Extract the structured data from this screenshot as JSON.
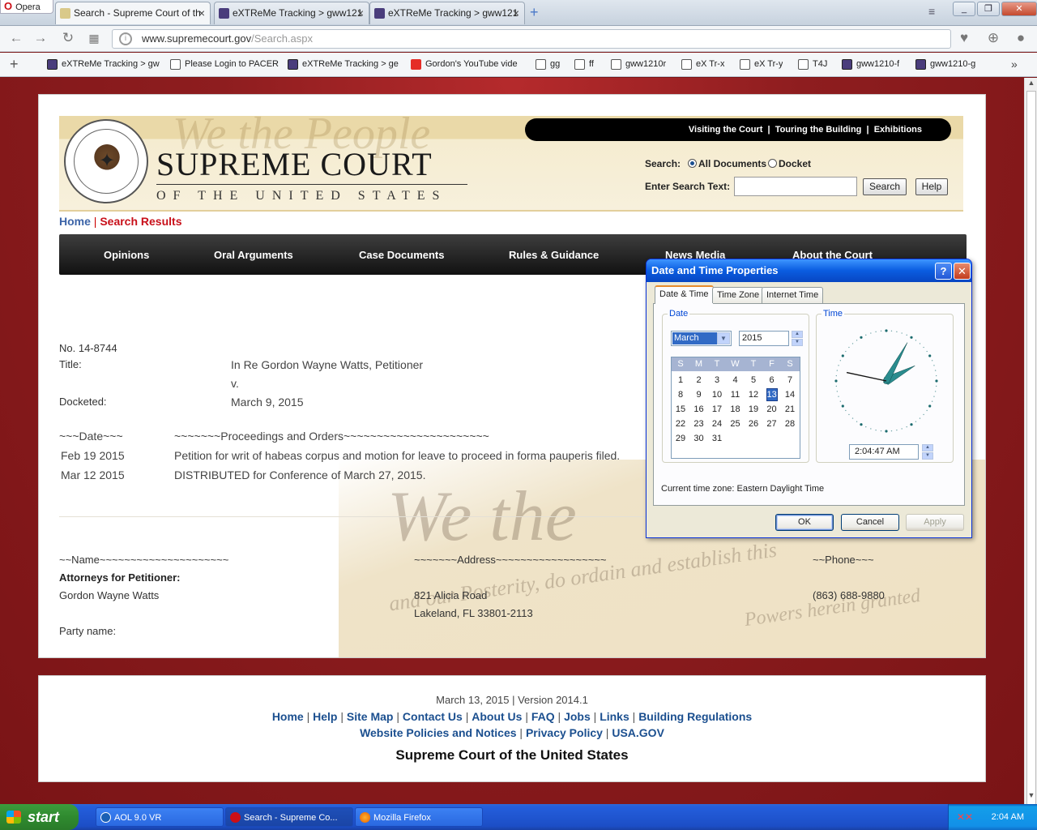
{
  "browser": {
    "menu_label": "Opera",
    "tabs": [
      {
        "title": "Search - Supreme Court of th"
      },
      {
        "title": "eXTReMe Tracking > gww121"
      },
      {
        "title": "eXTReMe Tracking > gww121"
      }
    ],
    "url_domain": "www.supremecourt.gov",
    "url_path": "/Search.aspx",
    "bookmarks": [
      {
        "label": "eXTReMe Tracking > gw"
      },
      {
        "label": "Please Login to PACER"
      },
      {
        "label": "eXTReMe Tracking > ge"
      },
      {
        "label": "Gordon's YouTube vide"
      },
      {
        "label": "gg"
      },
      {
        "label": "ff"
      },
      {
        "label": "gww1210r"
      },
      {
        "label": "eX Tr-x"
      },
      {
        "label": "eX Tr-y"
      },
      {
        "label": "T4J"
      },
      {
        "label": "gww1210-f"
      },
      {
        "label": "gww1210-g"
      }
    ]
  },
  "site": {
    "title": "SUPREME COURT",
    "subtitle": "OF THE UNITED STATES",
    "top_links": [
      "Visiting the Court",
      "Touring the Building",
      "Exhibitions"
    ],
    "search_label": "Search:",
    "radio_all": "All Documents",
    "radio_docket": "Docket",
    "enter_text_label": "Enter Search Text:",
    "search_button": "Search",
    "help_button": "Help",
    "breadcrumb_home": "Home",
    "breadcrumb_current": "Search Results",
    "main_nav": [
      "Opinions",
      "Oral Arguments",
      "Case Documents",
      "Rules & Guidance",
      "News Media",
      "About the Court"
    ]
  },
  "docket": {
    "number": "No. 14-8744",
    "title_label": "Title:",
    "title_value": "In Re Gordon Wayne Watts, Petitioner",
    "title_v": "v.",
    "docketed_label": "Docketed:",
    "docketed_value": "March 9, 2015",
    "date_header": "~~~Date~~~",
    "proceedings_header": "~~~~~~~Proceedings  and  Orders~~~~~~~~~~~~~~~~~~~~~~",
    "entries": [
      {
        "date": "Feb 19 2015",
        "text": "Petition for writ of habeas corpus and motion for leave to proceed in forma pauperis filed."
      },
      {
        "date": "Mar 12 2015",
        "text": "DISTRIBUTED for Conference of March 27, 2015."
      }
    ],
    "name_header": "~~Name~~~~~~~~~~~~~~~~~~~~~",
    "address_header": "~~~~~~~Address~~~~~~~~~~~~~~~~~~",
    "phone_header": "~~Phone~~~",
    "attorneys_label": "Attorneys for Petitioner:",
    "attorney_name": "Gordon Wayne Watts",
    "address_line1": "821 Alicia Road",
    "address_line2": "Lakeland, FL  33801-2113",
    "phone": "(863) 688-9880",
    "party_label": "Party name:"
  },
  "footer": {
    "version": "March 13, 2015 | Version 2014.1",
    "links_row1": [
      "Home",
      "Help",
      "Site Map",
      "Contact Us",
      "About Us",
      "FAQ",
      "Jobs",
      "Links",
      "Building Regulations"
    ],
    "links_row2": [
      "Website Policies and Notices",
      "Privacy Policy",
      "USA.GOV"
    ],
    "org": "Supreme Court of the United States"
  },
  "dialog": {
    "title": "Date and Time Properties",
    "tabs": [
      "Date & Time",
      "Time Zone",
      "Internet Time"
    ],
    "date_group": "Date",
    "time_group": "Time",
    "month": "March",
    "year": "2015",
    "weekdays": [
      "S",
      "M",
      "T",
      "W",
      "T",
      "F",
      "S"
    ],
    "days": [
      [
        1,
        2,
        3,
        4,
        5,
        6,
        7
      ],
      [
        8,
        9,
        10,
        11,
        12,
        13,
        14
      ],
      [
        15,
        16,
        17,
        18,
        19,
        20,
        21
      ],
      [
        22,
        23,
        24,
        25,
        26,
        27,
        28
      ],
      [
        29,
        30,
        31
      ]
    ],
    "selected_day": 13,
    "time": "2:04:47 AM",
    "clock": {
      "hour": 2,
      "minute": 4,
      "second": 47
    },
    "timezone_text": "Current time zone:  Eastern Daylight Time",
    "ok": "OK",
    "cancel": "Cancel",
    "apply": "Apply"
  },
  "taskbar": {
    "start": "start",
    "tasks": [
      {
        "label": "AOL 9.0 VR"
      },
      {
        "label": "Search - Supreme Co..."
      },
      {
        "label": "Mozilla Firefox"
      }
    ],
    "clock": "2:04 AM"
  }
}
